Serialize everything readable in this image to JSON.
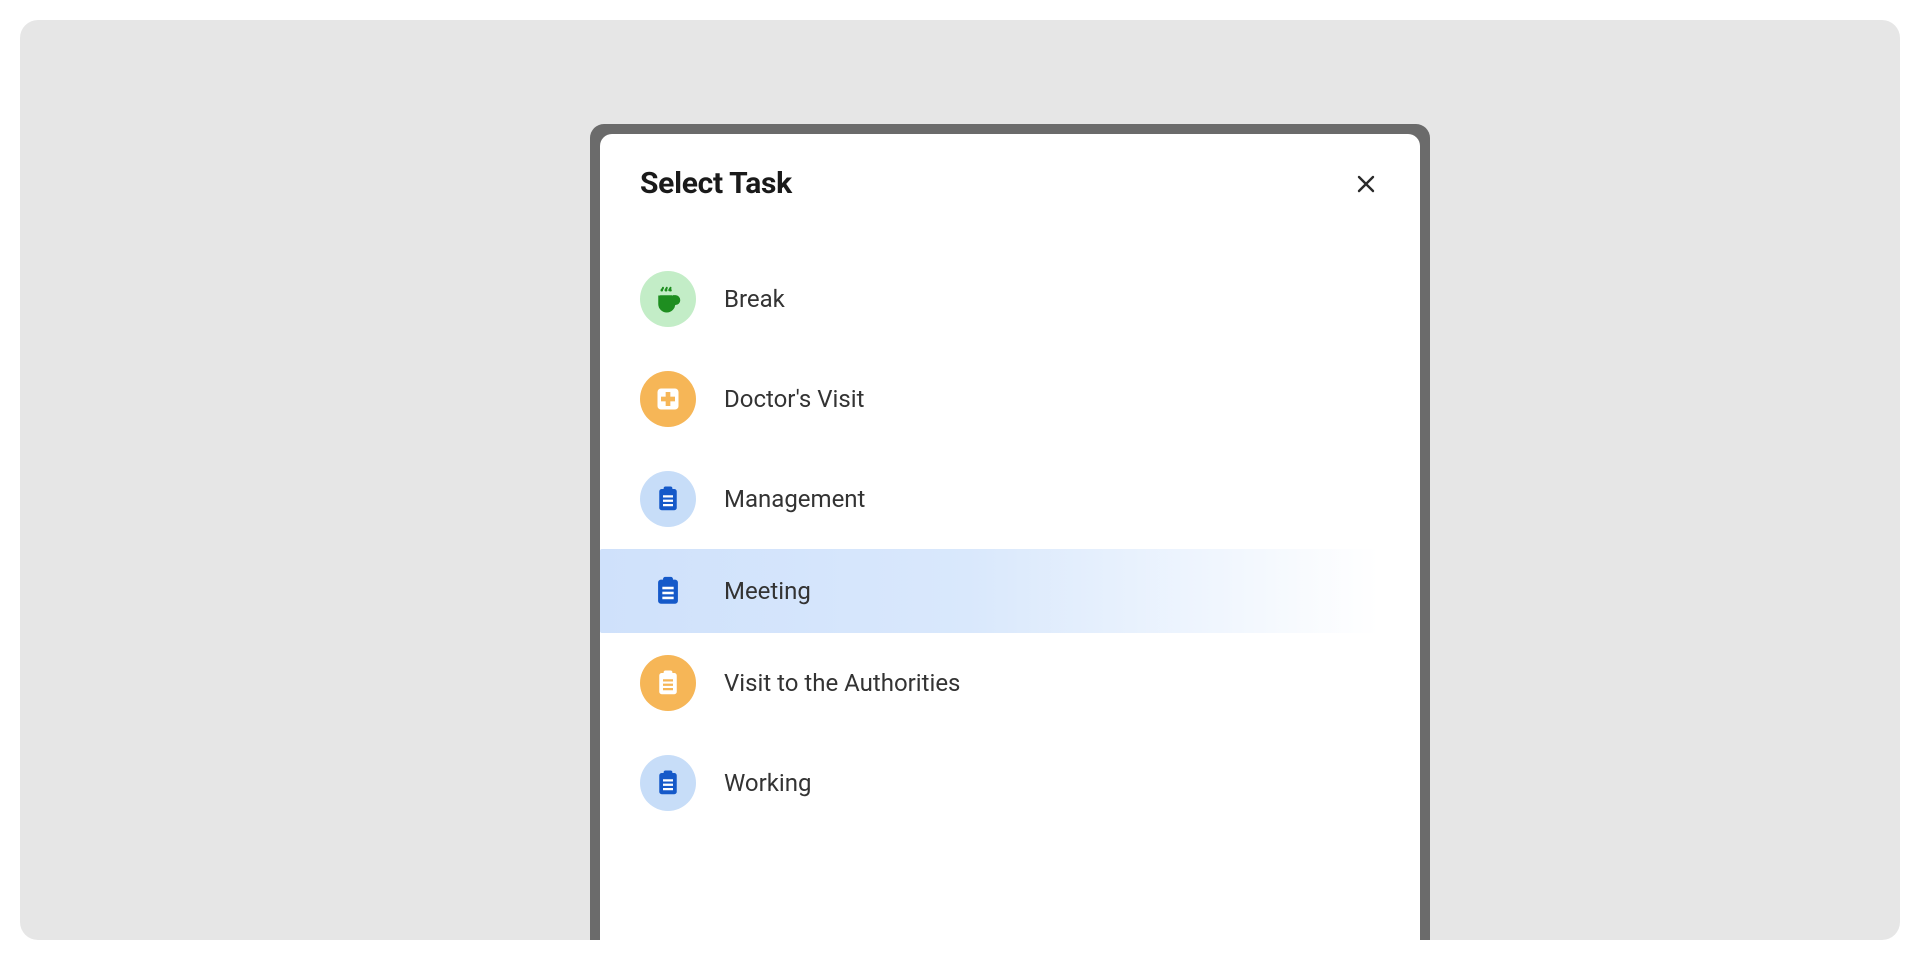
{
  "modal": {
    "title": "Select Task",
    "tasks": [
      {
        "label": "Break",
        "icon": "coffee",
        "bg": "green",
        "selected": false
      },
      {
        "label": "Doctor's Visit",
        "icon": "medical",
        "bg": "orange",
        "selected": false
      },
      {
        "label": "Management",
        "icon": "clipboard",
        "bg": "blue",
        "selected": false
      },
      {
        "label": "Meeting",
        "icon": "clipboard",
        "bg": "blue",
        "selected": true
      },
      {
        "label": "Visit to the Authorities",
        "icon": "clipboard",
        "bg": "orange",
        "selected": false
      },
      {
        "label": "Working",
        "icon": "clipboard",
        "bg": "blue",
        "selected": false
      }
    ]
  },
  "colors": {
    "icon_green": "#1e8e20",
    "icon_orange_bg_white": "#ffffff",
    "icon_blue": "#1559c9"
  }
}
